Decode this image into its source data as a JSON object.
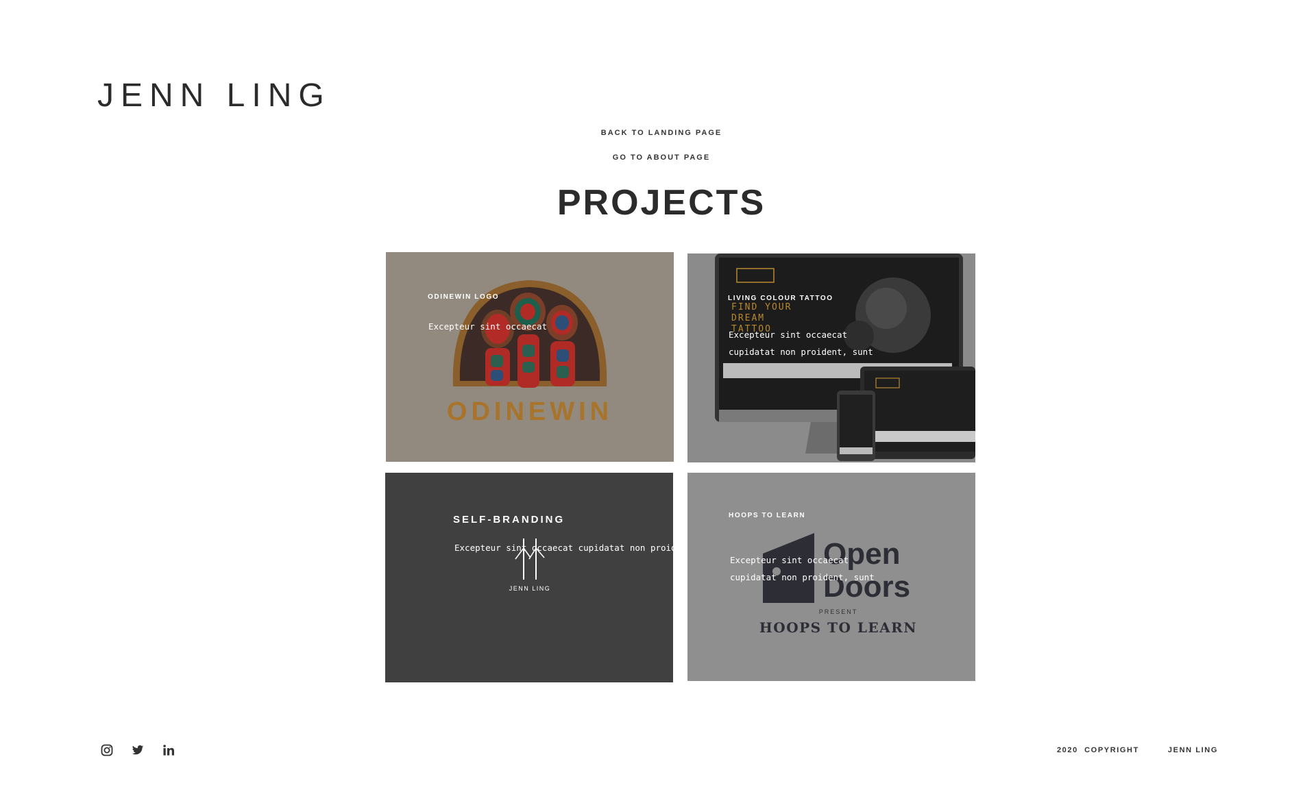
{
  "header": {
    "logo": "JENN LING",
    "links": [
      "BACK TO LANDING PAGE",
      "GO TO ABOUT PAGE"
    ]
  },
  "main": {
    "title": "PROJECTS",
    "projects": [
      {
        "title": "ODINEWIN LOGO",
        "description": "Excepteur sint occaecat",
        "image_text": "ODINEWIN"
      },
      {
        "title": "LIVING COLOUR TATTOO",
        "description_lines": [
          "Excepteur sint occaecat",
          "cupidatat non proident, sunt"
        ],
        "image_text": "FIND YOUR DREAM TATTOO"
      },
      {
        "title": "SELF-BRANDING",
        "description": "Excepteur sint occaecat cupidatat non proident,",
        "image_text": "JENN LING"
      },
      {
        "title": "HOOPS TO LEARN",
        "description_lines": [
          "Excepteur sint occaecat",
          "cupidatat non proident, sunt"
        ],
        "image_text_lines": [
          "Open",
          "Doors",
          "PRESENT",
          "HOOPS TO LEARN"
        ]
      }
    ]
  },
  "footer": {
    "social_icons": [
      "instagram-icon",
      "twitter-icon",
      "linkedin-icon"
    ],
    "copyright": "2020  COPYRIGHT",
    "name": "JENN LING"
  },
  "colors": {
    "text_dark": "#2b2b2b",
    "card1_bg": "#928a7f",
    "card3_bg": "#404040",
    "accent_gold": "#a8742b"
  }
}
